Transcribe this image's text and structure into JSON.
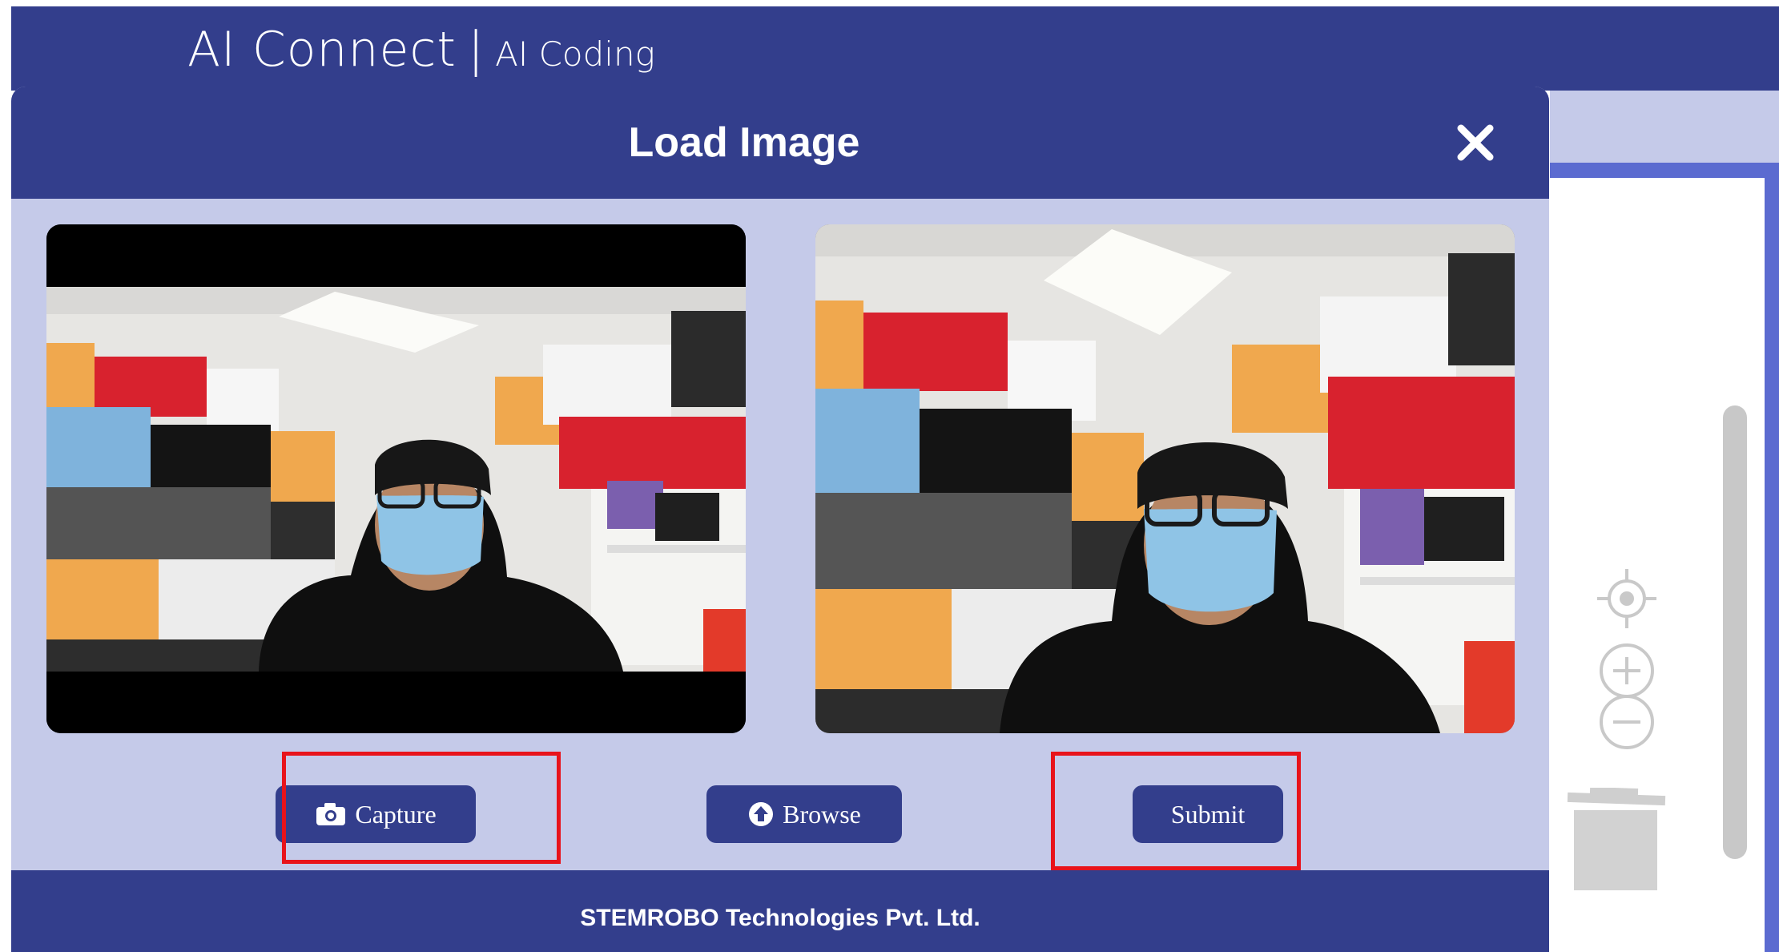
{
  "header": {
    "title_main": "AI Connect",
    "separator": "|",
    "title_sub": "AI Coding"
  },
  "modal": {
    "title": "Load Image",
    "close_icon": "close-icon",
    "left_image_label": "webcam-preview",
    "right_image_label": "captured-image",
    "buttons": {
      "capture_label": "Capture",
      "capture_icon": "camera-icon",
      "browse_label": "Browse",
      "browse_icon": "upload-circle-icon",
      "submit_label": "Submit"
    },
    "footer": "STEMROBO Technologies Pvt. Ltd."
  },
  "workspace_tools": [
    "recenter-icon",
    "zoom-in-icon",
    "zoom-out-icon",
    "trash-icon"
  ],
  "colors": {
    "primary": "#333e8c",
    "modal_body": "#c5cae9",
    "highlight": "#e8131b",
    "frame": "#5b6bd0"
  }
}
